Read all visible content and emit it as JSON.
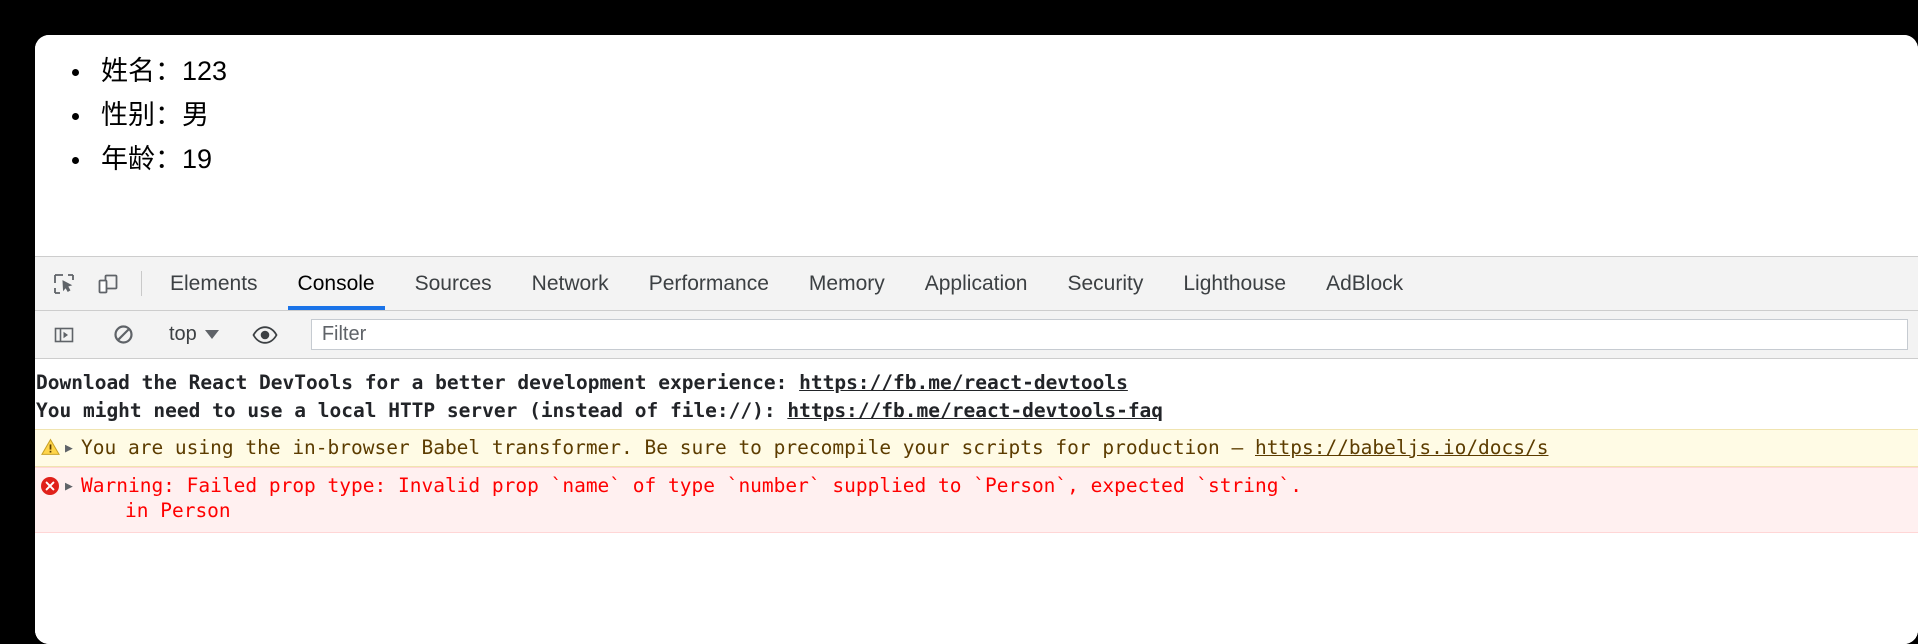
{
  "page": {
    "items": [
      "姓名：123",
      "性别：男",
      "年龄：19"
    ]
  },
  "devtools": {
    "toolbar_icons": [
      {
        "name": "inspect-element-icon",
        "label": "Inspect element"
      },
      {
        "name": "device-toolbar-icon",
        "label": "Toggle device toolbar"
      }
    ],
    "tabs": [
      {
        "label": "Elements",
        "active": false
      },
      {
        "label": "Console",
        "active": true
      },
      {
        "label": "Sources",
        "active": false
      },
      {
        "label": "Network",
        "active": false
      },
      {
        "label": "Performance",
        "active": false
      },
      {
        "label": "Memory",
        "active": false
      },
      {
        "label": "Application",
        "active": false
      },
      {
        "label": "Security",
        "active": false
      },
      {
        "label": "Lighthouse",
        "active": false
      },
      {
        "label": "AdBlock",
        "active": false
      }
    ],
    "active_tab": "Console",
    "accent_color": "#1a73e8"
  },
  "console_toolbar": {
    "sidebar_toggle": "show-console-sidebar-icon",
    "clear_console": "clear-console-icon",
    "context": "top",
    "eye_icon": "live-expression-eye-icon",
    "filter_placeholder": "Filter",
    "filter_value": ""
  },
  "console": {
    "messages": [
      {
        "level": "info",
        "lines": [
          {
            "text_before": "Download the React DevTools for a better development experience: ",
            "link": "https://fb.me/react-devtools",
            "text_after": ""
          },
          {
            "text_before": "You might need to use a local HTTP server (instead of file://): ",
            "link": "https://fb.me/react-devtools-faq",
            "text_after": ""
          }
        ]
      },
      {
        "level": "warning",
        "icon": "warning-triangle-icon",
        "expandable": true,
        "text_before": "You are using the in-browser Babel transformer. Be sure to precompile your scripts for production – ",
        "link": "https://babeljs.io/docs/s",
        "text_after": ""
      },
      {
        "level": "error",
        "icon": "error-circle-icon",
        "expandable": true,
        "text": "Warning: Failed prop type: Invalid prop `name` of type `number` supplied to `Person`, expected `string`.",
        "sub_text": "in Person"
      }
    ],
    "colors": {
      "warning_bg": "#fffbe5",
      "warning_text": "#5c3c00",
      "error_bg": "#fff0f0",
      "error_text": "#ff0000",
      "info_text": "#222428"
    }
  }
}
